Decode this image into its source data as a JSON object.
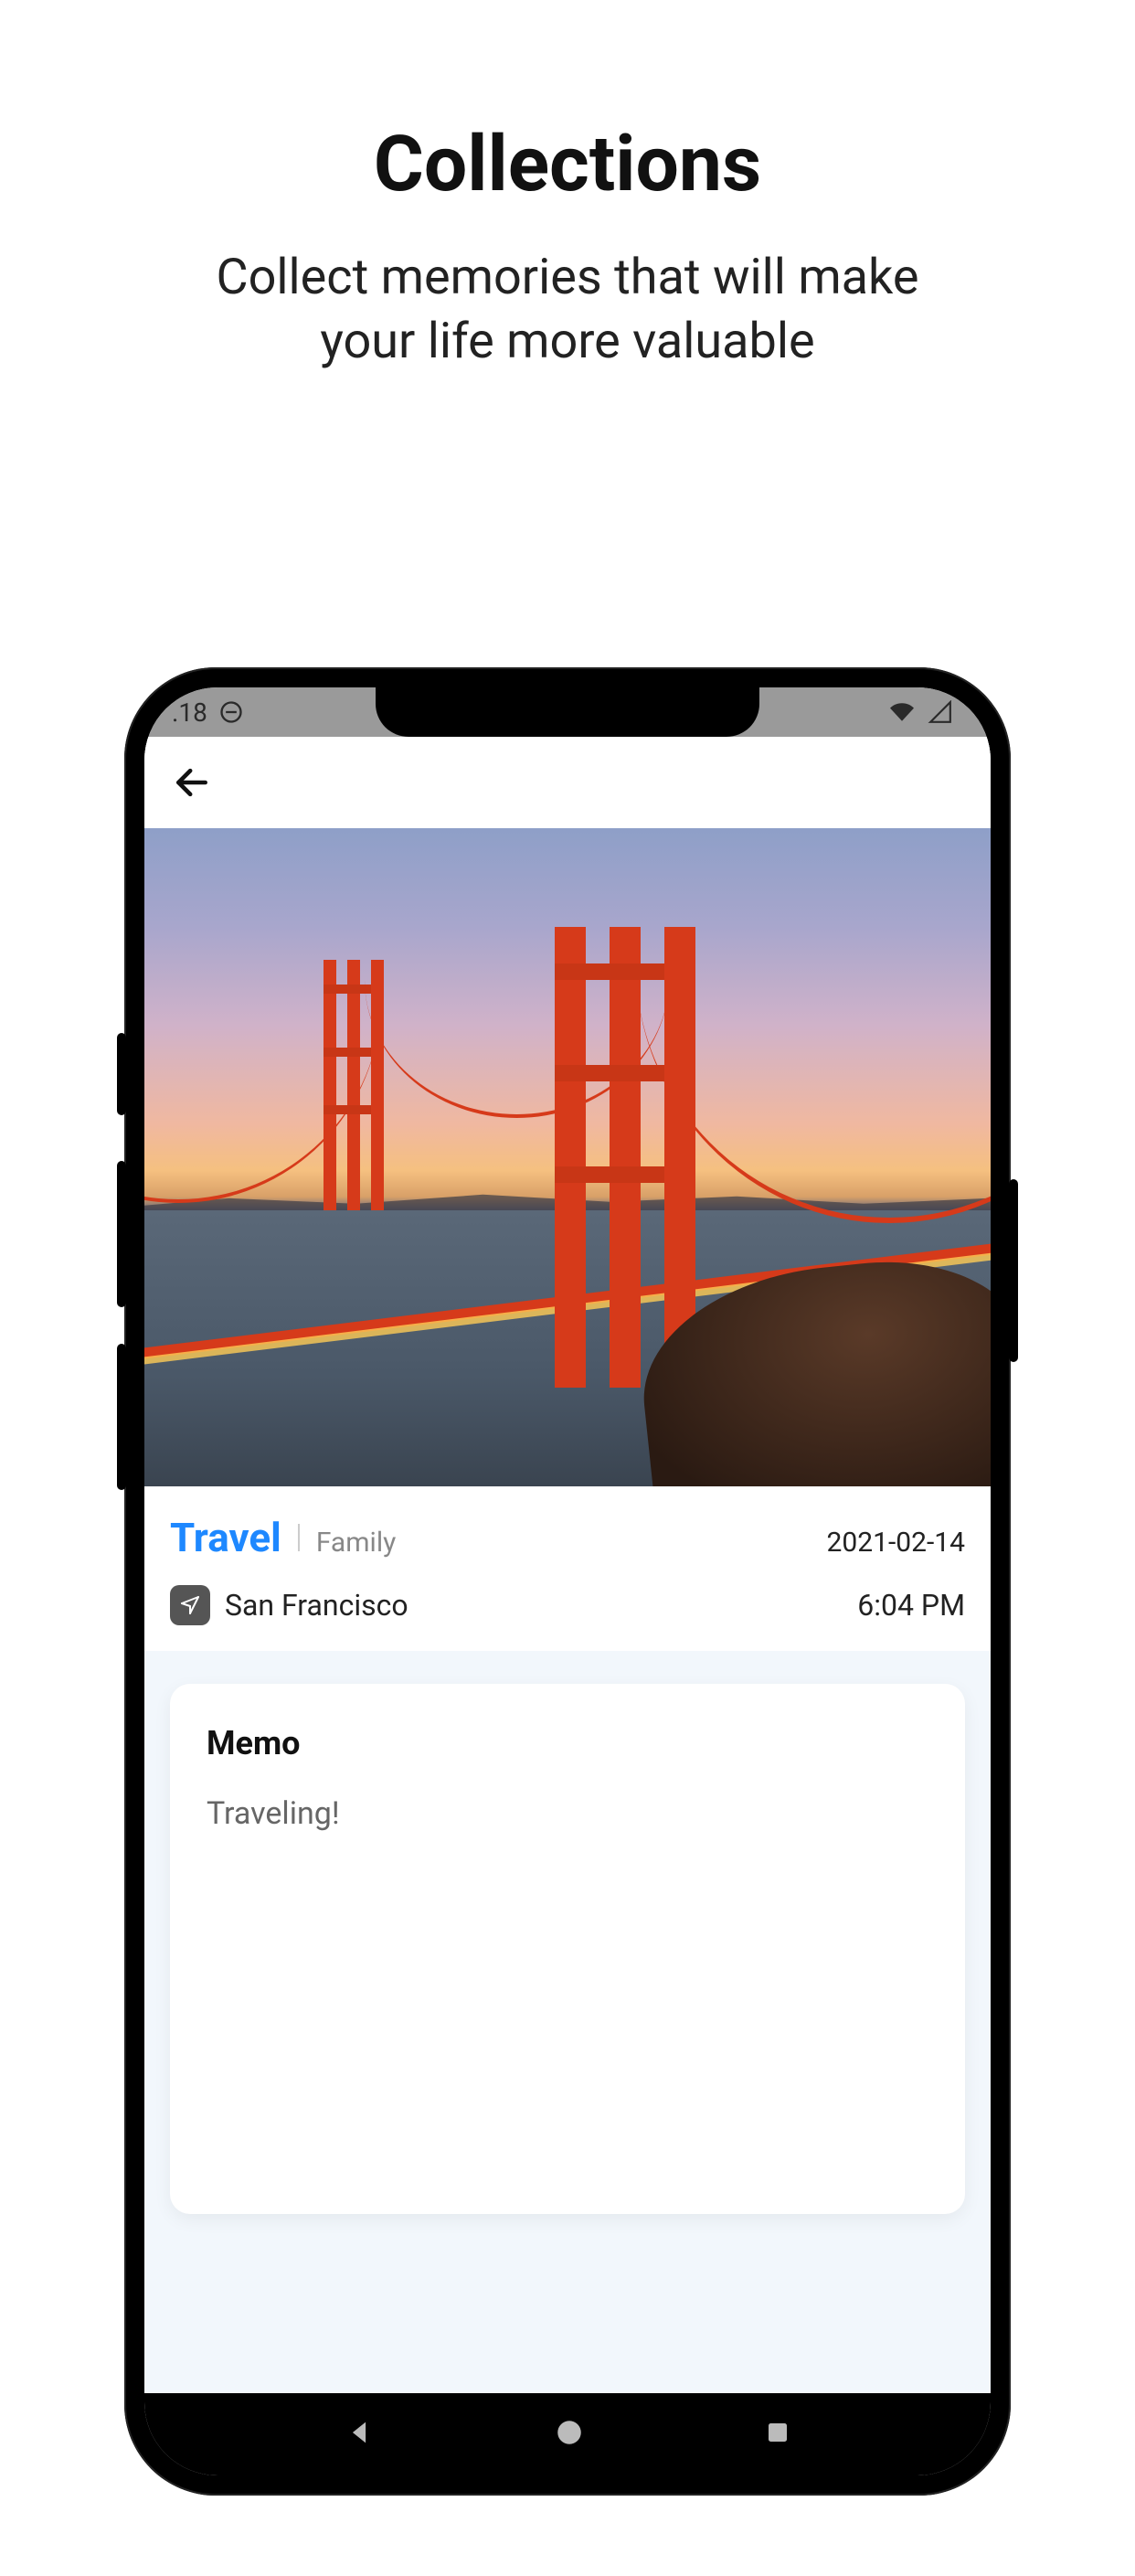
{
  "promo": {
    "title": "Collections",
    "subtitle_line1": "Collect memories that will make",
    "subtitle_line2": "your life more valuable"
  },
  "statusbar": {
    "time_fragment": ".18"
  },
  "detail": {
    "category": "Travel",
    "subcategory": "Family",
    "date": "2021-02-14",
    "location": "San Francisco",
    "time": "6:04 PM",
    "memo_title": "Memo",
    "memo_body": "Traveling!"
  }
}
